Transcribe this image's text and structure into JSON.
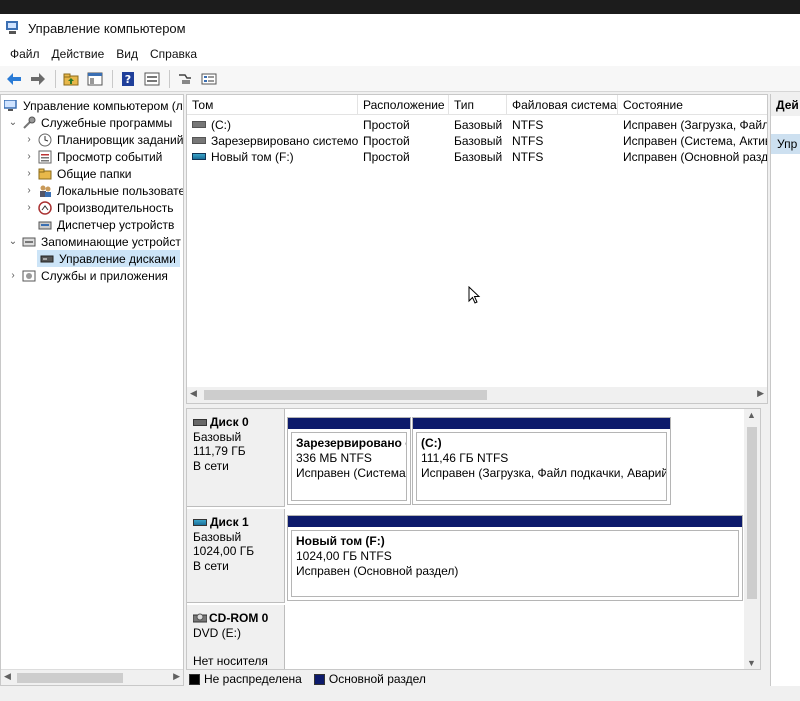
{
  "window": {
    "title": "Управление компьютером"
  },
  "menu": [
    "Файл",
    "Действие",
    "Вид",
    "Справка"
  ],
  "tree": {
    "root": "Управление компьютером (л",
    "items": [
      {
        "label": "Служебные программы",
        "level": 1,
        "expanded": true,
        "icon": "tools-icon"
      },
      {
        "label": "Планировщик заданий",
        "level": 2,
        "icon": "clock-icon"
      },
      {
        "label": "Просмотр событий",
        "level": 2,
        "icon": "event-viewer-icon"
      },
      {
        "label": "Общие папки",
        "level": 2,
        "icon": "shared-folder-icon"
      },
      {
        "label": "Локальные пользовате",
        "level": 2,
        "icon": "users-icon"
      },
      {
        "label": "Производительность",
        "level": 2,
        "icon": "performance-icon"
      },
      {
        "label": "Диспетчер устройств",
        "level": 2,
        "icon": "device-manager-icon"
      },
      {
        "label": "Запоминающие устройст",
        "level": 1,
        "expanded": true,
        "icon": "storage-icon"
      },
      {
        "label": "Управление дисками",
        "level": 2,
        "selected": true,
        "icon": "disk-management-icon"
      },
      {
        "label": "Службы и приложения",
        "level": 1,
        "expanded": false,
        "icon": "services-icon"
      }
    ]
  },
  "volumes": {
    "columns": [
      "Том",
      "Расположение",
      "Тип",
      "Файловая система",
      "Состояние"
    ],
    "rows": [
      {
        "name": "(C:)",
        "layout": "Простой",
        "type": "Базовый",
        "fs": "NTFS",
        "status": "Исправен (Загрузка, Файл"
      },
      {
        "name": "Зарезервировано системой",
        "layout": "Простой",
        "type": "Базовый",
        "fs": "NTFS",
        "status": "Исправен (Система, Актив"
      },
      {
        "name": "Новый том (F:)",
        "layout": "Простой",
        "type": "Базовый",
        "fs": "NTFS",
        "status": "Исправен (Основной разд"
      }
    ]
  },
  "disks": [
    {
      "name": "Диск 0",
      "type": "Базовый",
      "size": "111,79 ГБ",
      "state": "В сети",
      "partitions": [
        {
          "name": "Зарезервировано сі",
          "size": "336 МБ NTFS",
          "status": "Исправен (Система, ."
        },
        {
          "name": "(C:)",
          "size": "111,46 ГБ NTFS",
          "status": "Исправен (Загрузка, Файл подкачки, Аварий"
        }
      ]
    },
    {
      "name": "Диск 1",
      "type": "Базовый",
      "size": "1024,00 ГБ",
      "state": "В сети",
      "partitions": [
        {
          "name": "Новый том  (F:)",
          "size": "1024,00 ГБ NTFS",
          "status": "Исправен (Основной раздел)"
        }
      ]
    },
    {
      "name": "CD-ROM 0",
      "type": "DVD (E:)",
      "state": "Нет носителя"
    }
  ],
  "legend": {
    "unallocated": "Не распределена",
    "primary": "Основной раздел",
    "unallocated_color": "#000000",
    "primary_color": "#0c1a6b"
  },
  "actions": {
    "header": "Дей",
    "item": "Упр"
  }
}
